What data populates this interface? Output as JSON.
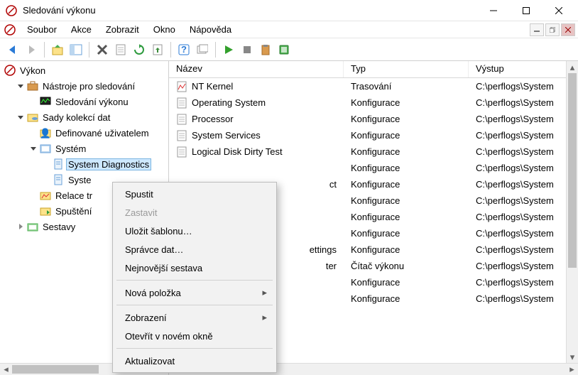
{
  "window": {
    "title": "Sledování výkonu"
  },
  "menu": {
    "items": [
      "Soubor",
      "Akce",
      "Zobrazit",
      "Okno",
      "Nápověda"
    ]
  },
  "tree": {
    "root": "Výkon",
    "nodes": [
      {
        "label": "Nástroje pro sledování",
        "indent": 1,
        "exp": "open",
        "icon": "toolbox"
      },
      {
        "label": "Sledování výkonu",
        "indent": 2,
        "exp": "none",
        "icon": "monitor"
      },
      {
        "label": "Sady kolekcí dat",
        "indent": 1,
        "exp": "open",
        "icon": "folder-db"
      },
      {
        "label": "Definované uživatelem",
        "indent": 2,
        "exp": "none",
        "icon": "folder-user"
      },
      {
        "label": "Systém",
        "indent": 2,
        "exp": "open",
        "icon": "system"
      },
      {
        "label": "System Diagnostics",
        "indent": 3,
        "exp": "none",
        "icon": "page",
        "selected": true
      },
      {
        "label": "Syste",
        "indent": 3,
        "exp": "none",
        "icon": "page",
        "clipped": true
      },
      {
        "label": "Relace tr",
        "indent": 2,
        "exp": "none",
        "icon": "folder-trace",
        "clipped": true
      },
      {
        "label": "Spuštění",
        "indent": 2,
        "exp": "none",
        "icon": "folder-start",
        "clipped": true
      },
      {
        "label": "Sestavy",
        "indent": 1,
        "exp": "closed",
        "icon": "reports"
      }
    ]
  },
  "list": {
    "headers": {
      "name": "Název",
      "type": "Typ",
      "output": "Výstup"
    },
    "rows": [
      {
        "name": "NT Kernel",
        "type": "Trasování",
        "out": "C:\\perflogs\\System",
        "icon": "trace"
      },
      {
        "name": "Operating System",
        "type": "Konfigurace",
        "out": "C:\\perflogs\\System",
        "icon": "config"
      },
      {
        "name": "Processor",
        "type": "Konfigurace",
        "out": "C:\\perflogs\\System",
        "icon": "config"
      },
      {
        "name": "System Services",
        "type": "Konfigurace",
        "out": "C:\\perflogs\\System",
        "icon": "config"
      },
      {
        "name": "Logical Disk Dirty Test",
        "type": "Konfigurace",
        "out": "C:\\perflogs\\System",
        "icon": "config"
      },
      {
        "name": "",
        "type": "Konfigurace",
        "out": "C:\\perflogs\\System",
        "icon": "config",
        "clipped": true
      },
      {
        "name": "ct",
        "type": "Konfigurace",
        "out": "C:\\perflogs\\System",
        "icon": "config",
        "clipped": true
      },
      {
        "name": "",
        "type": "Konfigurace",
        "out": "C:\\perflogs\\System",
        "icon": "config",
        "clipped": true
      },
      {
        "name": "",
        "type": "Konfigurace",
        "out": "C:\\perflogs\\System",
        "icon": "config",
        "clipped": true
      },
      {
        "name": "",
        "type": "Konfigurace",
        "out": "C:\\perflogs\\System",
        "icon": "config",
        "clipped": true
      },
      {
        "name": "ettings",
        "type": "Konfigurace",
        "out": "C:\\perflogs\\System",
        "icon": "config",
        "clipped": true
      },
      {
        "name": "ter",
        "type": "Čítač výkonu",
        "out": "C:\\perflogs\\System",
        "icon": "counter",
        "clipped": true
      },
      {
        "name": "",
        "type": "Konfigurace",
        "out": "C:\\perflogs\\System",
        "icon": "config",
        "clipped": true
      },
      {
        "name": "",
        "type": "Konfigurace",
        "out": "C:\\perflogs\\System",
        "icon": "config",
        "clipped": true
      }
    ]
  },
  "context_menu": {
    "items": [
      {
        "label": "Spustit"
      },
      {
        "label": "Zastavit",
        "disabled": true
      },
      {
        "label": "Uložit šablonu…"
      },
      {
        "label": "Správce dat…"
      },
      {
        "label": "Nejnovější sestava"
      },
      {
        "sep": true
      },
      {
        "label": "Nová položka",
        "sub": true
      },
      {
        "sep": true
      },
      {
        "label": "Zobrazení",
        "sub": true
      },
      {
        "label": "Otevřít v novém okně"
      },
      {
        "sep": true
      },
      {
        "label": "Aktualizovat"
      }
    ]
  }
}
